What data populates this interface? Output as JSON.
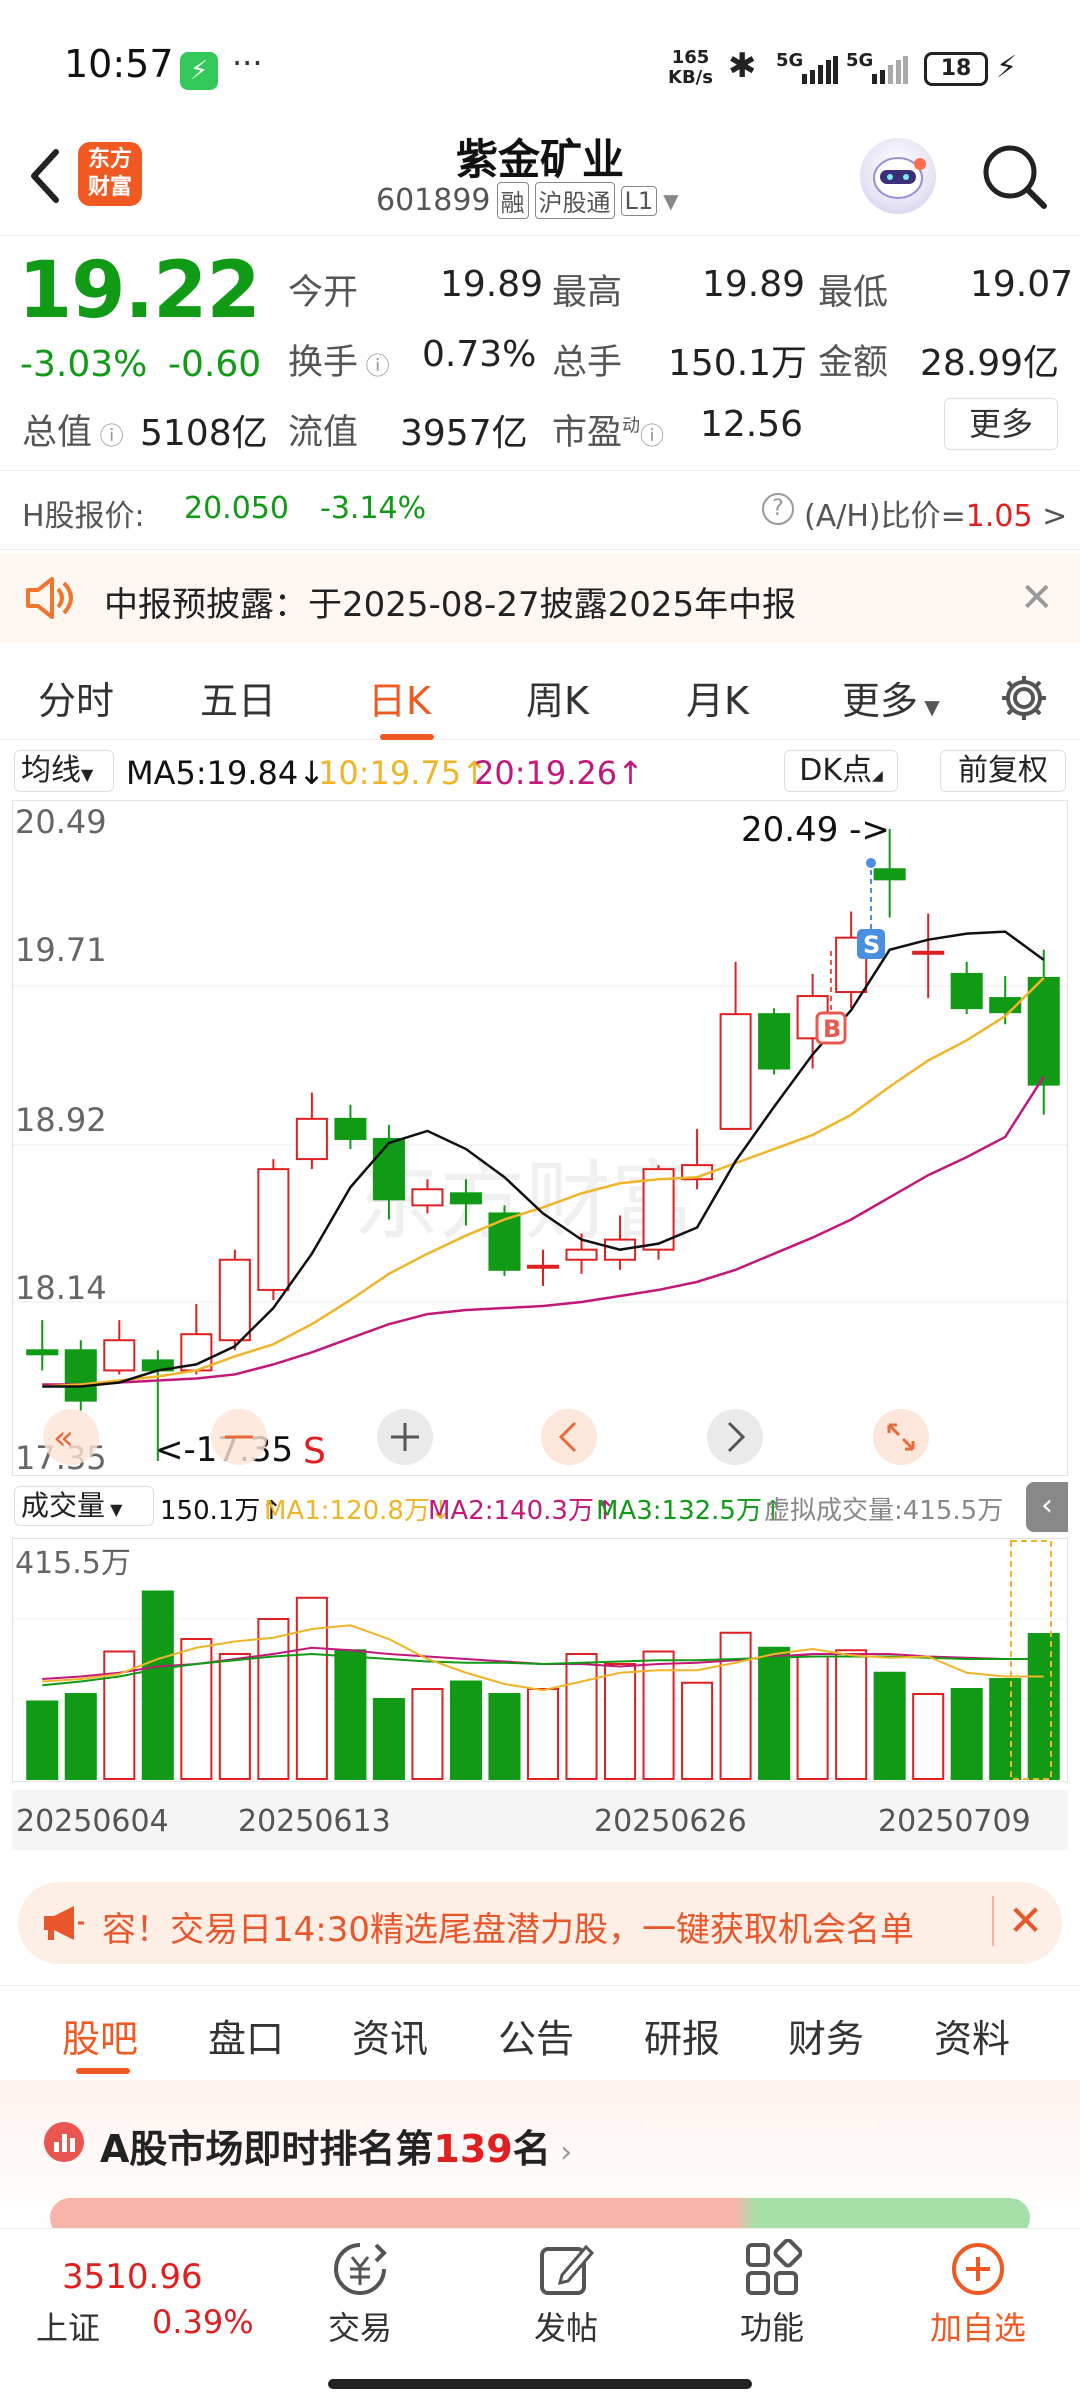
{
  "status_bar": {
    "time": "10:57",
    "net_speed_top": "165",
    "net_speed_bottom": "KB/s",
    "signal1": "5G",
    "signal2": "5G",
    "battery": "18"
  },
  "header": {
    "title": "紫金矿业",
    "code": "601899",
    "tag1": "融",
    "tag2": "沪股通",
    "tag3": "L1",
    "logo_line1": "东方",
    "logo_line2": "财富"
  },
  "quote": {
    "price": "19.22",
    "change_pct": "-3.03%",
    "change": "-0.60",
    "open_label": "今开",
    "open": "19.89",
    "high_label": "最高",
    "high": "19.89",
    "low_label": "最低",
    "low": "19.07",
    "turnover_label": "换手",
    "turnover": "0.73%",
    "volume_label": "总手",
    "volume": "150.1万",
    "amount_label": "金额",
    "amount": "28.99亿",
    "mktcap_label": "总值",
    "mktcap": "5108亿",
    "float_label": "流值",
    "float": "3957亿",
    "pe_label": "市盈",
    "pe_sup": "动",
    "pe": "12.56",
    "more_label": "更多"
  },
  "h_share": {
    "label": "H股报价:",
    "price": "20.050",
    "change": "-3.14%",
    "ratio_label": "(A/H)比价=",
    "ratio": "1.05",
    "arrow": ">"
  },
  "notice": {
    "text": "中报预披露：于2025-08-27披露2025年中报"
  },
  "period_tabs": [
    {
      "label": "分时"
    },
    {
      "label": "五日"
    },
    {
      "label": "日K"
    },
    {
      "label": "周K"
    },
    {
      "label": "月K"
    },
    {
      "label": "更多"
    }
  ],
  "chart_bar": {
    "ma_select": "均线",
    "ma5": "MA5:19.84",
    "ma10": "10:19.75",
    "ma20": "20:19.26",
    "dk": "DK点",
    "fq": "前复权"
  },
  "kline_labels": {
    "top": "20.49",
    "y2": "19.71",
    "y3": "18.92",
    "y4": "18.14",
    "bottom": "17.35",
    "max_note": "20.49",
    "min_note": "<-17.35",
    "s_mark": "S",
    "b_mark": "B",
    "s_tag": "S"
  },
  "vol_bar": {
    "select": "成交量",
    "vol": "150.1万",
    "ma1": "MA1:120.8万",
    "ma2": "MA2:140.3万",
    "ma3": "MA3:132.5万",
    "virtual": "虚拟成交量:415.5万",
    "scale": "415.5万"
  },
  "dates": [
    "20250604",
    "20250613",
    "20250626",
    "20250709"
  ],
  "promo": {
    "text": "容！交易日14:30精选尾盘潜力股，一键获取机会名单"
  },
  "sub_tabs": [
    {
      "label": "股吧"
    },
    {
      "label": "盘口"
    },
    {
      "label": "资讯"
    },
    {
      "label": "公告"
    },
    {
      "label": "研报"
    },
    {
      "label": "财务"
    },
    {
      "label": "资料"
    }
  ],
  "rank": {
    "prefix": "A股市场即时排名第",
    "number": "139",
    "suffix": "名"
  },
  "bottom_nav": {
    "index_value": "3510.96",
    "index_name": "上证",
    "index_change": "0.39%",
    "trade": "交易",
    "post": "发帖",
    "func": "功能",
    "add": "加自选"
  },
  "colors": {
    "up": "#e02020",
    "down": "#109a16",
    "accent": "#ff6a00",
    "ma5": "#111111",
    "ma10": "#f0b429",
    "ma20": "#c2187a"
  },
  "chart_data": {
    "type": "candlestick",
    "ylim": [
      17.35,
      20.49
    ],
    "y_ticks": [
      "20.49",
      "19.71",
      "18.92",
      "18.14",
      "17.35"
    ],
    "x_ticks": [
      "20250604",
      "20250613",
      "20250626",
      "20250709"
    ],
    "candles": [
      {
        "o": 17.9,
        "c": 17.88,
        "h": 18.05,
        "l": 17.8
      },
      {
        "o": 17.9,
        "c": 17.65,
        "h": 17.95,
        "l": 17.6
      },
      {
        "o": 17.8,
        "c": 17.95,
        "h": 18.05,
        "l": 17.78
      },
      {
        "o": 17.85,
        "c": 17.8,
        "h": 17.9,
        "l": 17.35
      },
      {
        "o": 17.8,
        "c": 17.98,
        "h": 18.13,
        "l": 17.78
      },
      {
        "o": 17.95,
        "c": 18.35,
        "h": 18.4,
        "l": 17.9
      },
      {
        "o": 18.2,
        "c": 18.8,
        "h": 18.85,
        "l": 18.15
      },
      {
        "o": 18.85,
        "c": 19.05,
        "h": 19.18,
        "l": 18.8
      },
      {
        "o": 19.05,
        "c": 18.95,
        "h": 19.12,
        "l": 18.9
      },
      {
        "o": 18.95,
        "c": 18.65,
        "h": 19.02,
        "l": 18.55
      },
      {
        "o": 18.62,
        "c": 18.7,
        "h": 18.75,
        "l": 18.58
      },
      {
        "o": 18.68,
        "c": 18.63,
        "h": 18.75,
        "l": 18.52
      },
      {
        "o": 18.58,
        "c": 18.3,
        "h": 18.62,
        "l": 18.27
      },
      {
        "o": 18.32,
        "c": 18.32,
        "h": 18.4,
        "l": 18.22
      },
      {
        "o": 18.35,
        "c": 18.4,
        "h": 18.48,
        "l": 18.28
      },
      {
        "o": 18.35,
        "c": 18.45,
        "h": 18.57,
        "l": 18.3
      },
      {
        "o": 18.4,
        "c": 18.8,
        "h": 18.82,
        "l": 18.35
      },
      {
        "o": 18.75,
        "c": 18.82,
        "h": 19.0,
        "l": 18.7
      },
      {
        "o": 19.0,
        "c": 19.57,
        "h": 19.83,
        "l": 19.0
      },
      {
        "o": 19.57,
        "c": 19.3,
        "h": 19.6,
        "l": 19.27
      },
      {
        "o": 19.45,
        "c": 19.66,
        "h": 19.77,
        "l": 19.3
      },
      {
        "o": 19.68,
        "c": 19.95,
        "h": 20.08,
        "l": 19.6
      },
      {
        "o": 20.29,
        "c": 20.24,
        "h": 20.49,
        "l": 20.05
      },
      {
        "o": 19.88,
        "c": 19.88,
        "h": 20.07,
        "l": 19.65
      },
      {
        "o": 19.77,
        "c": 19.6,
        "h": 19.83,
        "l": 19.57
      },
      {
        "o": 19.65,
        "c": 19.58,
        "h": 19.76,
        "l": 19.52
      },
      {
        "o": 19.75,
        "c": 19.22,
        "h": 19.89,
        "l": 19.07
      }
    ],
    "ma5": [
      17.72,
      17.72,
      17.74,
      17.8,
      17.83,
      17.92,
      18.11,
      18.38,
      18.71,
      18.93,
      18.99,
      18.9,
      18.76,
      18.58,
      18.45,
      18.4,
      18.43,
      18.51,
      18.84,
      19.11,
      19.37,
      19.59,
      19.89,
      19.94,
      19.97,
      19.98,
      19.84
    ],
    "ma10": [
      17.72,
      17.73,
      17.75,
      17.77,
      17.8,
      17.87,
      17.93,
      18.03,
      18.15,
      18.28,
      18.38,
      18.47,
      18.55,
      18.61,
      18.68,
      18.73,
      18.75,
      18.76,
      18.83,
      18.9,
      18.97,
      19.07,
      19.21,
      19.34,
      19.44,
      19.56,
      19.75
    ],
    "ma20": [
      17.73,
      17.73,
      17.74,
      17.75,
      17.76,
      17.78,
      17.83,
      17.89,
      17.96,
      18.03,
      18.08,
      18.1,
      18.11,
      18.12,
      18.14,
      18.17,
      18.2,
      18.24,
      18.3,
      18.38,
      18.46,
      18.55,
      18.66,
      18.77,
      18.86,
      18.96,
      19.26
    ],
    "volume": [
      62,
      68,
      102,
      150,
      112,
      100,
      128,
      145,
      103,
      64,
      72,
      78,
      68,
      72,
      100,
      92,
      102,
      77,
      117,
      105,
      98,
      103,
      85,
      68,
      72,
      80,
      116
    ],
    "vol_ma1": [
      78,
      80,
      84,
      96,
      105,
      110,
      113,
      120,
      123,
      112,
      96,
      85,
      76,
      71,
      78,
      85,
      87,
      87,
      93,
      100,
      104,
      99,
      97,
      98,
      85,
      82,
      82
    ],
    "vol_ma2": [
      80,
      82,
      85,
      90,
      92,
      96,
      100,
      105,
      103,
      100,
      98,
      96,
      94,
      92,
      92,
      90,
      92,
      93,
      95,
      98,
      100,
      100,
      100,
      98,
      97,
      96,
      96
    ],
    "vol_ma3": [
      75,
      78,
      82,
      88,
      92,
      95,
      98,
      100,
      98,
      96,
      94,
      93,
      93,
      92,
      93,
      94,
      95,
      95,
      96,
      97,
      98,
      98,
      98,
      97,
      96,
      96,
      96
    ]
  }
}
